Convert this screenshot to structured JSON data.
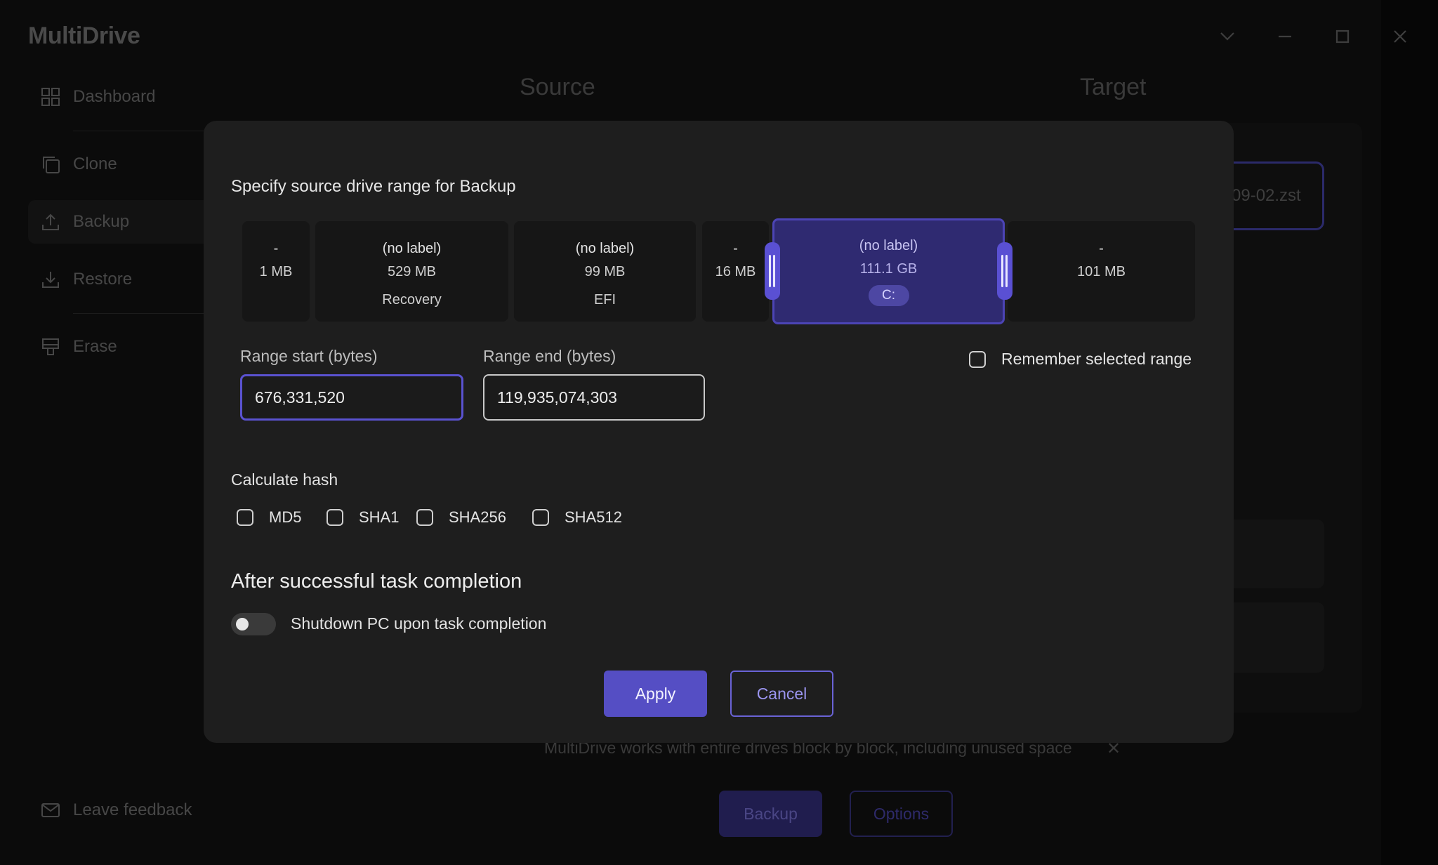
{
  "app": {
    "title": "MultiDrive",
    "window_controls": [
      "chevron-down",
      "minimize",
      "maximize",
      "close"
    ]
  },
  "sidebar": {
    "items": [
      {
        "label": "Dashboard",
        "icon": "grid-icon"
      },
      {
        "label": "Clone",
        "icon": "copy-icon"
      },
      {
        "label": "Backup",
        "icon": "upload-icon",
        "active": true
      },
      {
        "label": "Restore",
        "icon": "download-icon"
      },
      {
        "label": "Erase",
        "icon": "eraser-icon"
      }
    ],
    "feedback_label": "Leave feedback"
  },
  "background": {
    "source_heading": "Source",
    "target_heading": "Target",
    "target_file": "09-02.zst",
    "info_text": "MultiDrive works with entire drives block by block, including unused space",
    "info_close": "✕",
    "backup_button": "Backup",
    "options_button": "Options"
  },
  "dialog": {
    "title": "Specify source drive range for Backup",
    "partitions": [
      {
        "label": "-",
        "size": "1 MB",
        "name": ""
      },
      {
        "label": "(no label)",
        "size": "529 MB",
        "name": "Recovery"
      },
      {
        "label": "(no label)",
        "size": "99 MB",
        "name": "EFI"
      },
      {
        "label": "-",
        "size": "16 MB",
        "name": ""
      },
      {
        "label": "(no label)",
        "size": "111.1 GB",
        "name": "C:",
        "selected": true
      },
      {
        "label": "-",
        "size": "101 MB",
        "name": ""
      }
    ],
    "range_start_label": "Range start (bytes)",
    "range_start_value": "676,331,520",
    "range_end_label": "Range end (bytes)",
    "range_end_value": "119,935,074,303",
    "remember_label": "Remember selected range",
    "remember_checked": false,
    "hash_title": "Calculate hash",
    "hash_options": [
      {
        "label": "MD5",
        "checked": false
      },
      {
        "label": "SHA1",
        "checked": false
      },
      {
        "label": "SHA256",
        "checked": false
      },
      {
        "label": "SHA512",
        "checked": false
      }
    ],
    "after_title": "After successful task completion",
    "shutdown_label": "Shutdown PC upon task completion",
    "shutdown_enabled": false,
    "apply_label": "Apply",
    "cancel_label": "Cancel"
  },
  "colors": {
    "accent": "#554ec4",
    "selection": "#2f2a71",
    "dialog_bg": "#1e1e1e",
    "app_bg": "#0b0b0b"
  }
}
